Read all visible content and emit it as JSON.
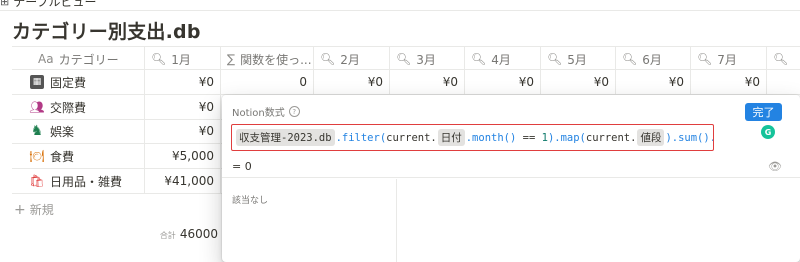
{
  "view_tab": {
    "icon": "table-icon",
    "label": "テーブルビュー"
  },
  "database": {
    "title": "カテゴリー別支出.db"
  },
  "columns": [
    {
      "icon": "Aa",
      "label": "カテゴリー"
    },
    {
      "icon": "🔍",
      "label": "1月"
    },
    {
      "icon": "∑",
      "label": "関数を使っ..."
    },
    {
      "icon": "🔍",
      "label": "2月"
    },
    {
      "icon": "🔍",
      "label": "3月"
    },
    {
      "icon": "🔍",
      "label": "4月"
    },
    {
      "icon": "🔍",
      "label": "5月"
    },
    {
      "icon": "🔍",
      "label": "6月"
    },
    {
      "icon": "🔍",
      "label": "7月"
    }
  ],
  "rows": [
    {
      "name": "固定費",
      "icon": "calculator-icon",
      "jan": "¥0",
      "func": "0",
      "feb": "¥0",
      "mar": "¥0",
      "apr": "¥0",
      "may": "¥0",
      "jun": "¥0",
      "jul": "¥0"
    },
    {
      "name": "交際費",
      "icon": "people-icon",
      "jan": "¥0"
    },
    {
      "name": "娯楽",
      "icon": "chess-knight-icon",
      "jan": "¥0"
    },
    {
      "name": "食費",
      "icon": "dining-icon",
      "jan": "¥5,000"
    },
    {
      "name": "日用品・雑費",
      "icon": "shopping-bag-icon",
      "jan": "¥41,000"
    }
  ],
  "new_label": "新規",
  "sum": {
    "label": "合計",
    "value": "46000"
  },
  "formula_editor": {
    "title": "Notion数式",
    "help": "?",
    "done_label": "完了",
    "tokens": [
      {
        "t": "prop",
        "v": "収支管理-2023.db"
      },
      {
        "t": "fn",
        "v": ".filter("
      },
      {
        "t": "text",
        "v": "current."
      },
      {
        "t": "prop",
        "v": "日付"
      },
      {
        "t": "fn",
        "v": ".month()"
      },
      {
        "t": "text",
        "v": " == "
      },
      {
        "t": "num",
        "v": "1"
      },
      {
        "t": "fn",
        "v": ").map("
      },
      {
        "t": "text",
        "v": "current."
      },
      {
        "t": "prop",
        "v": "値段"
      },
      {
        "t": "fn",
        "v": ").sum().toNumber()"
      }
    ],
    "result_prefix": "=",
    "result_value": "0",
    "no_match": "該当なし"
  }
}
